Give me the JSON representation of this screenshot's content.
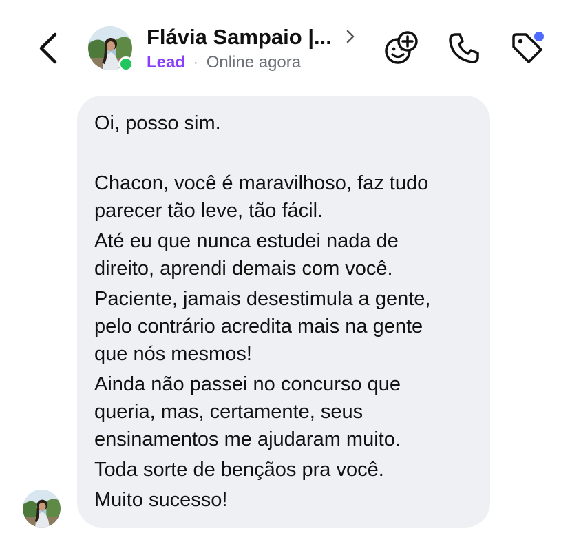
{
  "header": {
    "contact_name": "Flávia Sampaio |...",
    "lead_label": "Lead",
    "separator": "·",
    "status_text": "Online agora",
    "icons": {
      "back": "chevron-left-icon",
      "open_profile": "chevron-right-icon",
      "add_reaction": "add-emoji-icon",
      "call": "phone-icon",
      "tags": "tag-icon"
    },
    "colors": {
      "lead": "#8a3ffc",
      "online": "#22c55e",
      "notification": "#4f6bff"
    }
  },
  "message": {
    "lines": [
      "Oi, posso sim.",
      "Chacon, você é maravilhoso, faz tudo",
      "parecer tão leve, tão fácil.",
      "Até eu que nunca estudei nada de",
      "direito, aprendi demais com você.",
      "Paciente, jamais desestimula a gente,",
      "pelo contrário acredita mais na gente",
      "que nós mesmos!",
      "Ainda não passei no concurso que",
      "queria, mas, certamente, seus",
      "ensinamentos me ajudaram muito.",
      "Toda sorte de bençãos pra você.",
      "Muito sucesso!"
    ],
    "bubble_color": "#eef0f3"
  }
}
